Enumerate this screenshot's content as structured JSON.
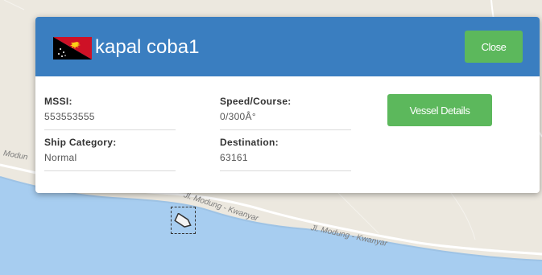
{
  "popup": {
    "title": "kapal coba1",
    "flag_icon": "papua-new-guinea-flag-icon",
    "close_label": "Close",
    "details_label": "Vessel Details",
    "fields": {
      "mmsi": {
        "label": "MSSI:",
        "value": "553553555"
      },
      "speed_course": {
        "label": "Speed/Course:",
        "value": "0/300Â°"
      },
      "ship_category": {
        "label": "Ship Category:",
        "value": "Normal"
      },
      "destination": {
        "label": "Destination:",
        "value": "63161"
      }
    }
  },
  "map": {
    "labels": {
      "left_edge": "Modun",
      "road1": "Jl. Modung - Kwanyar",
      "road2": "Jl. Modung - Kwanyar"
    },
    "vessel_icon": "ship-icon",
    "colors": {
      "land": "#ece8df",
      "water": "#a7cdf0",
      "header": "#3a7ec0",
      "button": "#5cb85c"
    }
  }
}
